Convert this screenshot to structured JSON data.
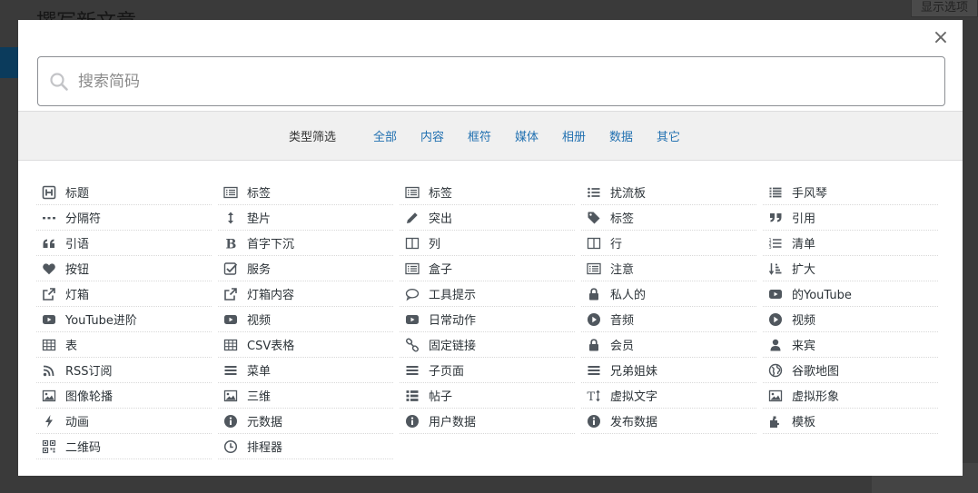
{
  "background": {
    "page_title": "撰写新文章",
    "screen_options": "显示选项"
  },
  "modal": {
    "close_label": "×",
    "search": {
      "placeholder": "搜索简码",
      "value": ""
    },
    "filter": {
      "label": "类型筛选",
      "links": [
        "全部",
        "内容",
        "框符",
        "媒体",
        "相册",
        "数据",
        "其它"
      ]
    },
    "shortcodes": [
      [
        {
          "label": "标题",
          "icon": "heading-icon"
        },
        {
          "label": "分隔符",
          "icon": "ellipsis-icon"
        },
        {
          "label": "引语",
          "icon": "quote-left-icon"
        },
        {
          "label": "按钮",
          "icon": "heart-icon"
        },
        {
          "label": "灯箱",
          "icon": "external-link-icon"
        },
        {
          "label": "YouTube进阶",
          "icon": "youtube-icon"
        },
        {
          "label": "表",
          "icon": "table-icon"
        },
        {
          "label": "RSS订阅",
          "icon": "rss-icon"
        },
        {
          "label": "图像轮播",
          "icon": "image-icon"
        },
        {
          "label": "动画",
          "icon": "bolt-icon"
        },
        {
          "label": "二维码",
          "icon": "qrcode-icon"
        }
      ],
      [
        {
          "label": "标签",
          "icon": "list-alt-icon"
        },
        {
          "label": "垫片",
          "icon": "arrows-v-icon"
        },
        {
          "label": "首字下沉",
          "icon": "bold-icon"
        },
        {
          "label": "服务",
          "icon": "check-square-icon"
        },
        {
          "label": "灯箱内容",
          "icon": "external-link-icon"
        },
        {
          "label": "视频",
          "icon": "youtube-icon"
        },
        {
          "label": "CSV表格",
          "icon": "table-icon"
        },
        {
          "label": "菜单",
          "icon": "bars-icon"
        },
        {
          "label": "三维",
          "icon": "image-icon"
        },
        {
          "label": "元数据",
          "icon": "info-circle-icon"
        },
        {
          "label": "排程器",
          "icon": "clock-icon"
        }
      ],
      [
        {
          "label": "标签",
          "icon": "list-alt-icon"
        },
        {
          "label": "突出",
          "icon": "pencil-icon"
        },
        {
          "label": "列",
          "icon": "columns-icon"
        },
        {
          "label": "盒子",
          "icon": "list-alt-icon"
        },
        {
          "label": "工具提示",
          "icon": "comment-icon"
        },
        {
          "label": "日常动作",
          "icon": "youtube-icon"
        },
        {
          "label": "固定链接",
          "icon": "link-icon"
        },
        {
          "label": "子页面",
          "icon": "bars-icon"
        },
        {
          "label": "帖子",
          "icon": "th-list-icon"
        },
        {
          "label": "用户数据",
          "icon": "info-circle-icon"
        }
      ],
      [
        {
          "label": "扰流板",
          "icon": "list-ul-icon"
        },
        {
          "label": "标签",
          "icon": "tag-icon"
        },
        {
          "label": "行",
          "icon": "columns-icon"
        },
        {
          "label": "注意",
          "icon": "list-alt-icon"
        },
        {
          "label": "私人的",
          "icon": "lock-icon"
        },
        {
          "label": "音频",
          "icon": "play-circle-icon"
        },
        {
          "label": "会员",
          "icon": "lock-icon"
        },
        {
          "label": "兄弟姐妹",
          "icon": "bars-icon"
        },
        {
          "label": "虚拟文字",
          "icon": "text-height-icon"
        },
        {
          "label": "发布数据",
          "icon": "info-circle-icon"
        }
      ],
      [
        {
          "label": "手风琴",
          "icon": "list-icon"
        },
        {
          "label": "引用",
          "icon": "quote-right-icon"
        },
        {
          "label": "清单",
          "icon": "list-ol-icon"
        },
        {
          "label": "扩大",
          "icon": "sort-amount-icon"
        },
        {
          "label": "的YouTube",
          "icon": "youtube-icon"
        },
        {
          "label": "视频",
          "icon": "play-circle-icon"
        },
        {
          "label": "来宾",
          "icon": "user-icon"
        },
        {
          "label": "谷歌地图",
          "icon": "globe-icon"
        },
        {
          "label": "虚拟形象",
          "icon": "image-icon"
        },
        {
          "label": "模板",
          "icon": "puzzle-icon"
        }
      ]
    ]
  },
  "colors": {
    "link": "#2271b1",
    "text": "#2c3338",
    "icon": "#50575e",
    "filter_bg": "#f0f0f0"
  }
}
